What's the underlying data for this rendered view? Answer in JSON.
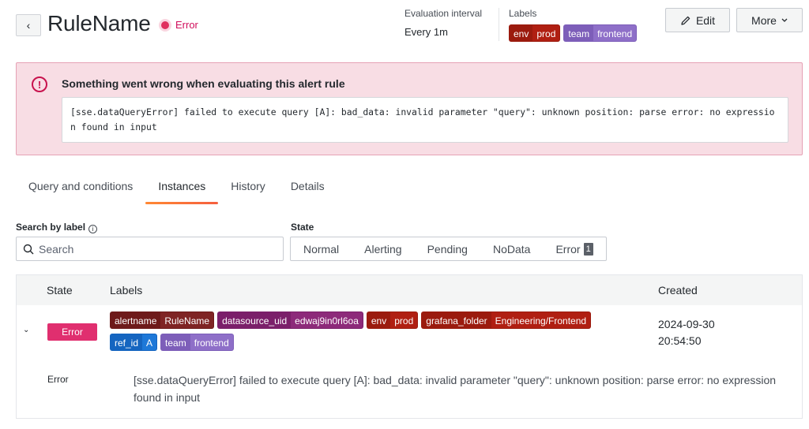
{
  "header": {
    "back_icon": "chevron-left-icon",
    "title": "RuleName",
    "state": "Error",
    "state_color": "#e02f5d",
    "evaluation_interval_label": "Evaluation interval",
    "evaluation_interval_value": "Every 1m",
    "labels_label": "Labels",
    "labels": [
      {
        "key": "env",
        "value": "prod"
      },
      {
        "key": "team",
        "value": "frontend"
      }
    ],
    "edit_label": "Edit",
    "more_label": "More"
  },
  "alert": {
    "title": "Something went wrong when evaluating this alert rule",
    "message": "[sse.dataQueryError] failed to execute query [A]: bad_data: invalid parameter \"query\": unknown position: parse error: no expression found in input",
    "bg_color": "#f8dde4"
  },
  "tabs": [
    {
      "label": "Query and conditions",
      "active": false
    },
    {
      "label": "Instances",
      "active": true
    },
    {
      "label": "History",
      "active": false
    },
    {
      "label": "Details",
      "active": false
    }
  ],
  "filters": {
    "search_label": "Search by label",
    "search_placeholder": "Search",
    "state_label": "State",
    "state_options": [
      "Normal",
      "Alerting",
      "Pending",
      "NoData",
      "Error"
    ],
    "error_count": "1"
  },
  "table": {
    "columns": [
      "State",
      "Labels",
      "Created"
    ],
    "rows": [
      {
        "state": "Error",
        "labels": [
          {
            "key": "alertname",
            "value": "RuleName"
          },
          {
            "key": "datasource_uid",
            "value": "edwaj9in0rl6oa"
          },
          {
            "key": "env",
            "value": "prod"
          },
          {
            "key": "grafana_folder",
            "value": "Engineering/Frontend"
          },
          {
            "key": "ref_id",
            "value": "A"
          },
          {
            "key": "team",
            "value": "frontend"
          }
        ],
        "created_date": "2024-09-30",
        "created_time": "20:54:50",
        "detail_key": "Error",
        "detail_value": "[sse.dataQueryError] failed to execute query [A]: bad_data: invalid parameter \"query\": unknown position: parse error: no expression found in input"
      }
    ]
  }
}
